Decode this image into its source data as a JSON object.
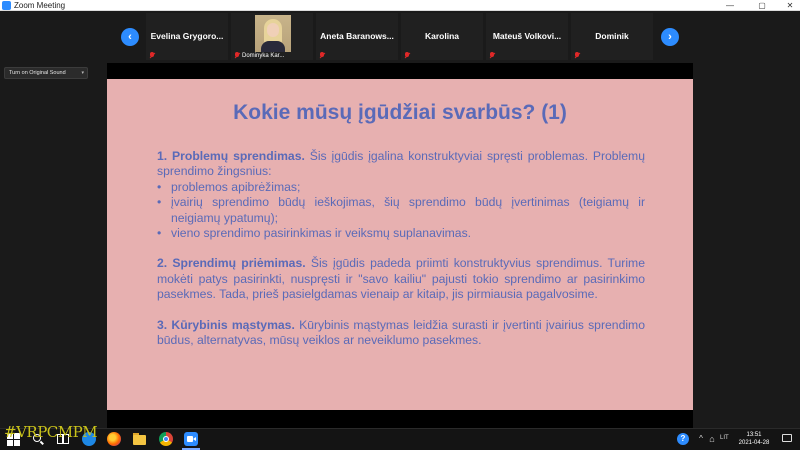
{
  "window": {
    "title": "Zoom Meeting"
  },
  "gallery": {
    "participants": [
      {
        "name": "Evelina Grygoro..."
      },
      {
        "name": "Dominyka Kar..."
      },
      {
        "name": "Aneta Baranows..."
      },
      {
        "name": "Karolina"
      },
      {
        "name": "Mateuš Volkovi..."
      },
      {
        "name": "Dominik"
      }
    ]
  },
  "sound_button": {
    "label": "Turn on Original Sound"
  },
  "slide": {
    "title": "Kokie mūsų įgūdžiai svarbūs? (1)",
    "s1_head": "1. Problemų sprendimas.",
    "s1_text": " Šis įgūdis įgalina konstruktyviai spręsti problemas. Problemų sprendimo žingsnius:",
    "bullets": [
      "problemos apibrėžimas;",
      "įvairių sprendimo būdų ieškojimas, šių sprendimo būdų įvertinimas (teigiamų ir neigiamų ypatumų);",
      " vieno sprendimo pasirinkimas ir veiksmų suplanavimas."
    ],
    "s2_head": "2. Sprendimų priėmimas.",
    "s2_text": " Šis įgūdis padeda priimti konstruktyvius sprendimus. Turime mokėti patys pasirinkti, nuspręsti ir \"savo kailiu\" pajusti tokio sprendimo ar pasirinkimo pasekmes. Tada, prieš pasielgdamas vienaip ar kitaip, jis pirmiausia pagalvosime.",
    "s3_head": "3. Kūrybinis mąstymas.",
    "s3_text": " Kūrybinis mąstymas leidžia surasti ir įvertinti įvairius sprendimo būdus, alternatyvas, mūsų veiklos ar neveiklumo pasekmes."
  },
  "taskbar": {
    "language": "LIT",
    "time": "13:51",
    "date": "2021-04-28"
  },
  "watermark": "#VRPCMPM",
  "colors": {
    "accent": "#2d8cff",
    "slide_bg": "#e7b0b0",
    "slide_text": "#5a6ab8",
    "muted_red": "#e02828"
  }
}
